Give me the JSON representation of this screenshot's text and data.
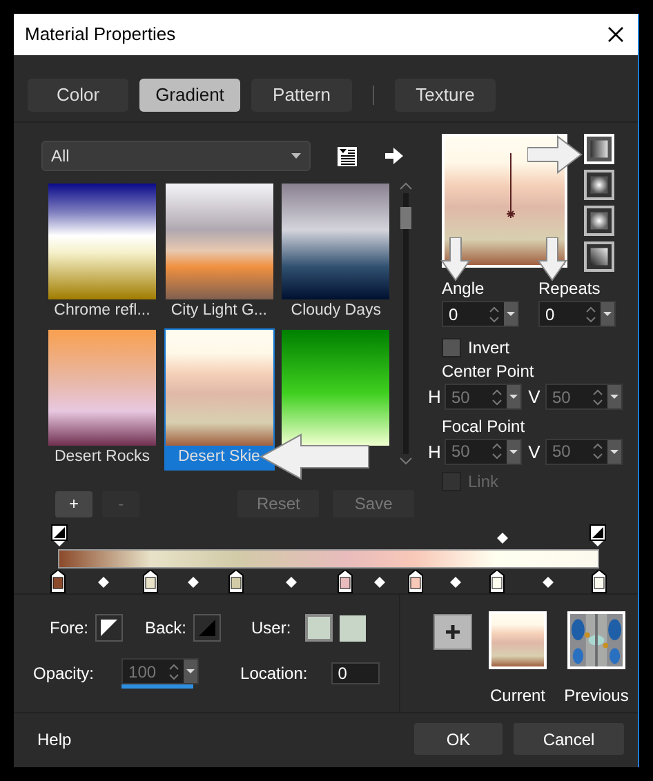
{
  "window": {
    "title": "Material Properties"
  },
  "tabs": [
    {
      "label": "Color",
      "selected": false
    },
    {
      "label": "Gradient",
      "selected": true
    },
    {
      "label": "Pattern",
      "selected": false
    },
    {
      "label": "Texture",
      "selected": false
    }
  ],
  "gradient_list": {
    "filter": "All",
    "items": [
      {
        "label": "Chrome refl...",
        "selected": false
      },
      {
        "label": "City Light G...",
        "selected": false
      },
      {
        "label": "Cloudy Days",
        "selected": false
      },
      {
        "label": "Desert Rocks",
        "selected": false
      },
      {
        "label": "Desert Skie",
        "selected": true
      },
      {
        "selected": false
      }
    ]
  },
  "style_buttons": [
    {
      "selected": true
    },
    {
      "selected": false
    },
    {
      "selected": false
    },
    {
      "selected": false
    }
  ],
  "angle": {
    "label": "Angle",
    "value": "0"
  },
  "repeats": {
    "label": "Repeats",
    "value": "0"
  },
  "invert": {
    "label": "Invert",
    "checked": false
  },
  "center_point": {
    "label": "Center Point",
    "h_label": "H",
    "h": "50",
    "v_label": "V",
    "v": "50"
  },
  "focal_point": {
    "label": "Focal Point",
    "h_label": "H",
    "h": "50",
    "v_label": "V",
    "v": "50"
  },
  "link": {
    "label": "Link",
    "checked": false,
    "disabled": true
  },
  "stop_buttons": [
    {
      "label": "+",
      "disabled": false
    },
    {
      "label": "-",
      "disabled": true
    }
  ],
  "action_buttons": [
    {
      "label": "Reset",
      "disabled": true
    },
    {
      "label": "Save",
      "disabled": true
    }
  ],
  "stops": [
    {
      "color": "#8b4a2b"
    },
    {
      "color": "#e8e2c8"
    },
    {
      "color": "#d2cba8"
    },
    {
      "color": "#e8bcbc"
    },
    {
      "color": "#f8c8b8"
    },
    {
      "color": "#fffff0"
    },
    {
      "color": "#fcfaee"
    }
  ],
  "fore_label": "Fore:",
  "back_label": "Back:",
  "user_label": "User:",
  "opacity": {
    "label": "Opacity:",
    "value": "100",
    "disabled": true
  },
  "location": {
    "label": "Location:",
    "value": "0"
  },
  "swatches": [
    {
      "label": "Current"
    },
    {
      "label": "Previous"
    }
  ],
  "footer": {
    "help": "Help",
    "ok": "OK",
    "cancel": "Cancel"
  }
}
